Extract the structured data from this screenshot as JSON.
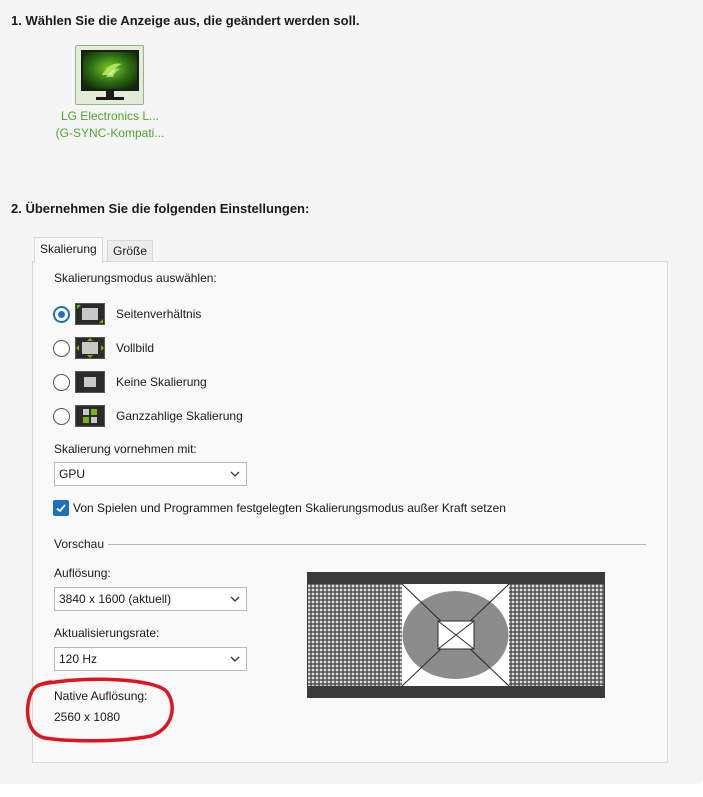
{
  "step1": {
    "heading": "1. Wählen Sie die Anzeige aus, die geändert werden soll."
  },
  "display": {
    "name_line1": "LG Electronics L...",
    "name_line2": "(G-SYNC-Kompati...",
    "icon": "nvidia-monitor-icon"
  },
  "step2": {
    "heading": "2. Übernehmen Sie die folgenden Einstellungen:"
  },
  "tabs": [
    {
      "label": "Skalierung",
      "active": true
    },
    {
      "label": "Größe",
      "active": false
    }
  ],
  "scaling": {
    "mode_label": "Skalierungsmodus auswählen:",
    "options": [
      {
        "label": "Seitenverhältnis",
        "selected": true,
        "icon": "aspect-ratio-icon"
      },
      {
        "label": "Vollbild",
        "selected": false,
        "icon": "fullscreen-icon"
      },
      {
        "label": "Keine Skalierung",
        "selected": false,
        "icon": "no-scaling-icon"
      },
      {
        "label": "Ganzzahlige Skalierung",
        "selected": false,
        "icon": "integer-scaling-icon"
      }
    ],
    "perform_label": "Skalierung vornehmen mit:",
    "perform_value": "GPU",
    "override_label": "Von Spielen und Programmen festgelegten Skalierungsmodus außer Kraft setzen",
    "override_checked": true
  },
  "preview": {
    "group_label": "Vorschau",
    "resolution_label": "Auflösung:",
    "resolution_value": "3840 x 1600 (aktuell)",
    "refresh_label": "Aktualisierungsrate:",
    "refresh_value": "120 Hz",
    "native_label": "Native Auflösung:",
    "native_value": "2560 x 1080"
  },
  "colors": {
    "nvidia_green": "#4ca62d",
    "accent_blue": "#1f6fbf",
    "annotation_red": "#e0141e"
  }
}
